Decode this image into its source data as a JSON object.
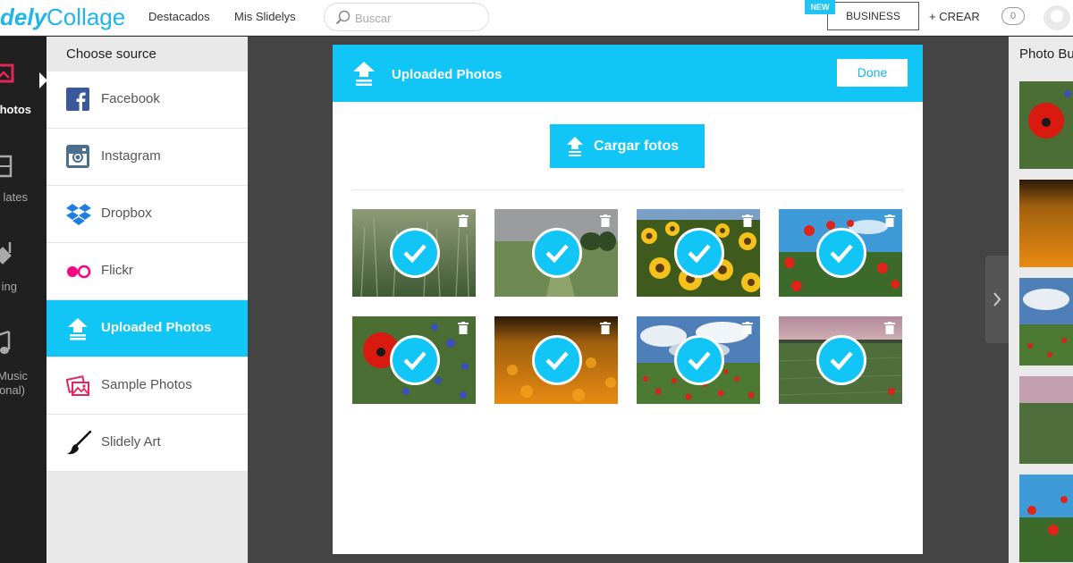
{
  "app": {
    "logo_part1": "dely",
    "logo_part2": "Collage"
  },
  "topnav": {
    "featured": "Destacados",
    "my_slidelys": "Mis Slidelys",
    "search_placeholder": "Buscar",
    "new_badge": "NEW",
    "business": "BUSINESS",
    "create": "+ CREAR",
    "notifications": "0"
  },
  "leftrail": {
    "items": [
      {
        "label": "hotos",
        "icon": "photos-icon",
        "active": true
      },
      {
        "label": "lates",
        "icon": "templates-icon",
        "active": false
      },
      {
        "label": "ing",
        "icon": "styling-icon",
        "active": false
      },
      {
        "label": "Music",
        "label2": "onal)",
        "icon": "music-icon",
        "active": false
      }
    ]
  },
  "source": {
    "title": "Choose source",
    "items": [
      {
        "label": "Facebook",
        "icon": "facebook-icon"
      },
      {
        "label": "Instagram",
        "icon": "instagram-icon"
      },
      {
        "label": "Dropbox",
        "icon": "dropbox-icon"
      },
      {
        "label": "Flickr",
        "icon": "flickr-icon"
      },
      {
        "label": "Uploaded Photos",
        "icon": "upload-icon",
        "active": true
      },
      {
        "label": "Sample Photos",
        "icon": "sample-photos-icon"
      },
      {
        "label": "Slidely Art",
        "icon": "brush-icon"
      }
    ]
  },
  "modal": {
    "title": "Uploaded Photos",
    "done": "Done",
    "upload_button": "Cargar fotos",
    "photos": [
      {
        "scene": "wheat-field",
        "selected": true
      },
      {
        "scene": "green-field-trees",
        "selected": true
      },
      {
        "scene": "sunflowers",
        "selected": true
      },
      {
        "scene": "red-poppies-sky",
        "selected": true
      },
      {
        "scene": "red-poppy-cornflowers",
        "selected": true
      },
      {
        "scene": "orange-flower-field",
        "selected": true
      },
      {
        "scene": "poppy-field-clouds",
        "selected": true
      },
      {
        "scene": "green-field-dusk",
        "selected": true
      }
    ]
  },
  "right_panel": {
    "title": "Photo Bu"
  },
  "colors": {
    "accent": "#11c6f7",
    "rail": "#202020",
    "stage": "#444444"
  }
}
